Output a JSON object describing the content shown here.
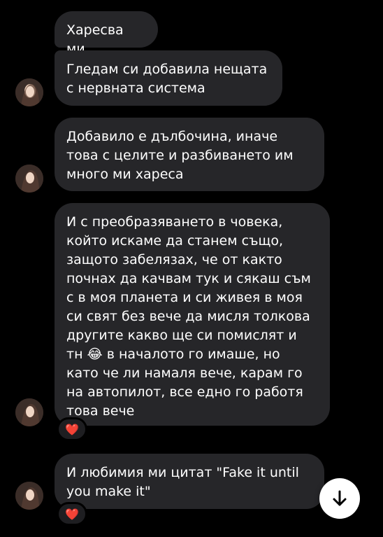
{
  "messages": [
    {
      "text": "Харесва ми"
    },
    {
      "text": "Гледам си добавила нещата с нервната система"
    },
    {
      "text": "Добавило е дълбочина, иначе това с целите и разбиването им много ми хареса"
    },
    {
      "text": "И с преобразяването в човека, който искаме да станем също, защото забелязах, че от както почнах да качвам тук и сякаш съм с в моя планета и си живея в моя си свят без вече да мисля толкова другите какво ще си помислят и тн 😂 в началото го имаше, но като че ли намаля вече, карам го на автопилот, все едно го работя това вече",
      "reaction": "❤️"
    },
    {
      "text": "И любимия ми цитат \"Fake it until you make it\"",
      "reaction": "❤️"
    }
  ],
  "icons": {
    "avatar": "profile-avatar",
    "scroll": "arrow-down-icon"
  },
  "colors": {
    "background": "#000000",
    "bubble": "#262629",
    "text": "#ffffff",
    "heart": "#ff3040"
  }
}
